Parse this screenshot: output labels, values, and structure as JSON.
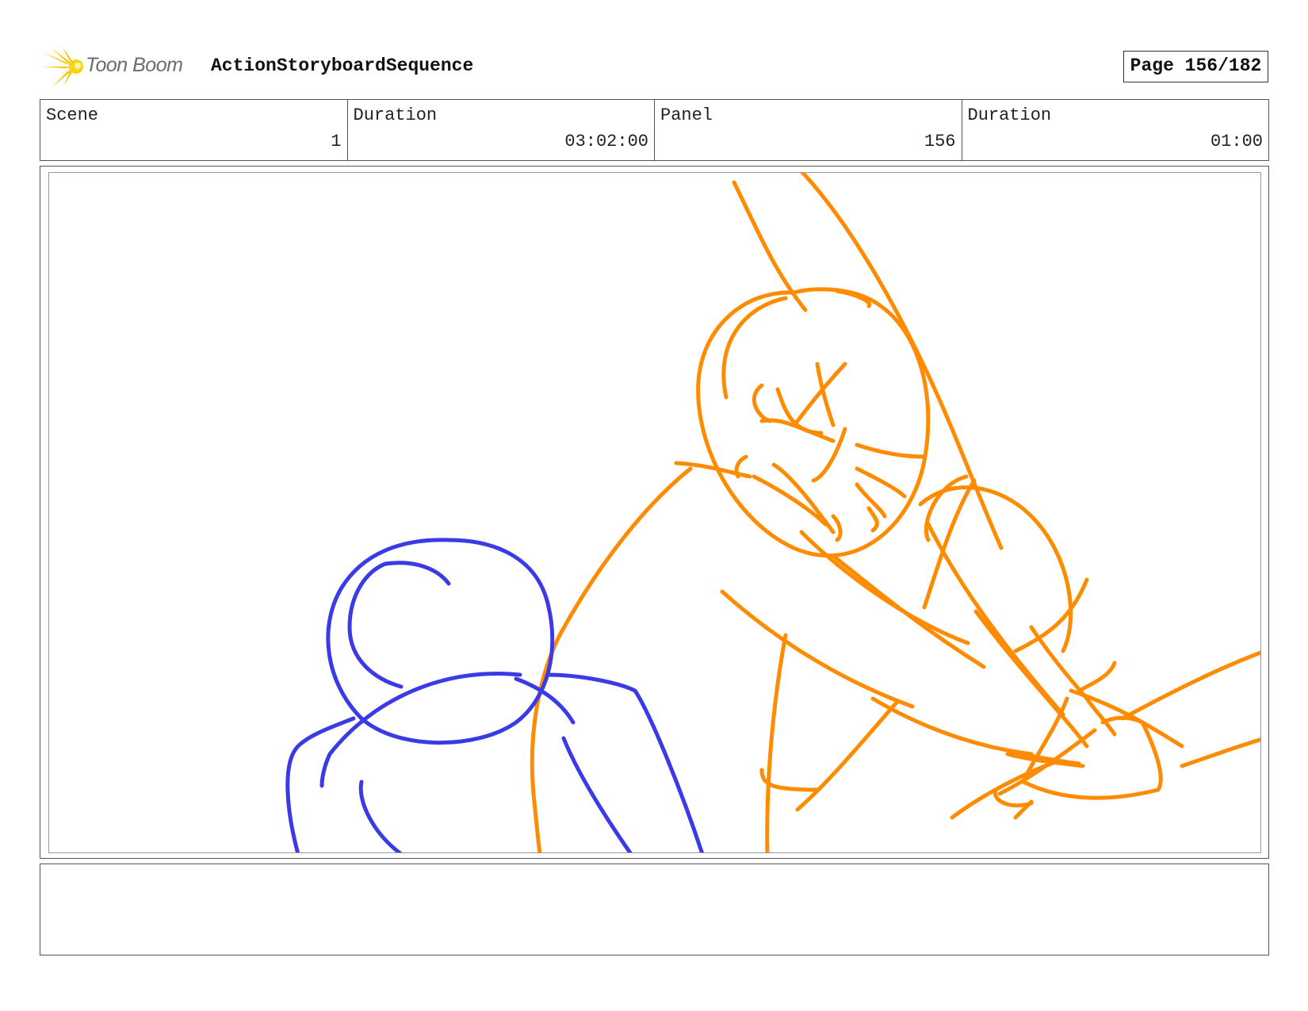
{
  "header": {
    "logo_text": "Toon Boom",
    "logo_icon": "toon-boom-burst-icon",
    "sequence_title": "ActionStoryboardSequence",
    "page_indicator": "Page 156/182"
  },
  "info": {
    "scene_label": "Scene",
    "scene_value": "1",
    "scene_duration_label": "Duration",
    "scene_duration_value": "03:02:00",
    "panel_label": "Panel",
    "panel_value": "156",
    "panel_duration_label": "Duration",
    "panel_duration_value": "01:00"
  },
  "sketch": {
    "foreground_character_color": "#3a3ae6",
    "background_character_color": "#ff8c00"
  },
  "notes": {
    "text": ""
  }
}
